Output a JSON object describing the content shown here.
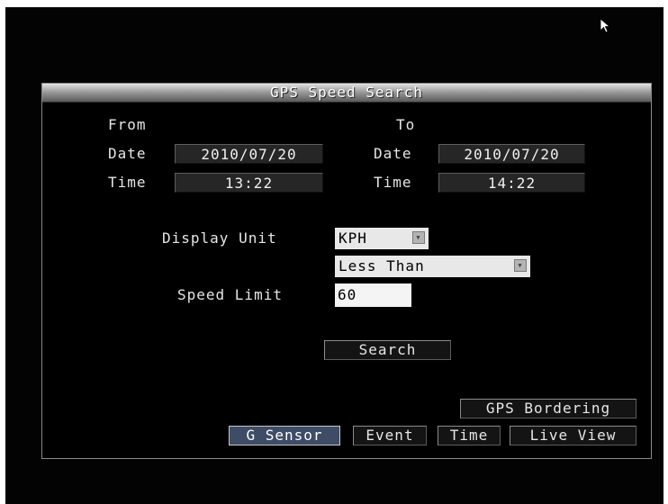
{
  "dialog": {
    "title": "GPS Speed Search"
  },
  "from": {
    "heading": "From",
    "date_label": "Date",
    "date_value": "2010/07/20",
    "time_label": "Time",
    "time_value": "13:22"
  },
  "to": {
    "heading": "To",
    "date_label": "Date",
    "date_value": "2010/07/20",
    "time_label": "Time",
    "time_value": "14:22"
  },
  "display_unit": {
    "label": "Display Unit",
    "value": "KPH"
  },
  "comparison": {
    "value": "Less Than"
  },
  "speed_limit": {
    "label": "Speed Limit",
    "value": "60"
  },
  "search_button": "Search",
  "gps_bordering_button": "GPS Bordering",
  "bottom_tabs": {
    "g_sensor": "G Sensor",
    "event": "Event",
    "time": "Time",
    "live_view": "Live View"
  },
  "icons": {
    "cursor": "mouse-pointer-icon",
    "dropdown": "chevron-down-icon"
  }
}
